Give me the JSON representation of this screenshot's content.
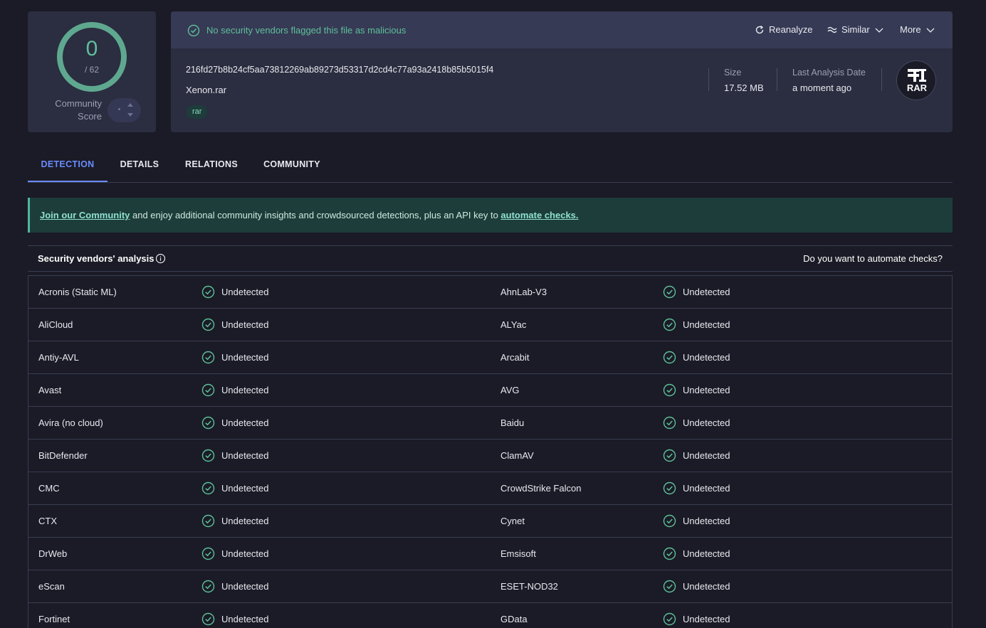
{
  "score": {
    "value": "0",
    "total": "/ 62",
    "label_line1": "Community",
    "label_line2": "Score"
  },
  "file": {
    "status": "No security vendors flagged this file as malicious",
    "reanalyze": "Reanalyze",
    "similar": "Similar",
    "more": "More",
    "hash": "216fd27b8b24cf5aa73812269ab89273d53317d2cd4c77a93a2418b85b5015f4",
    "name": "Xenon.rar",
    "tag": "rar",
    "size_label": "Size",
    "size_value": "17.52 MB",
    "date_label": "Last Analysis Date",
    "date_value": "a moment ago",
    "type_badge": "RAR"
  },
  "tabs": [
    "DETECTION",
    "DETAILS",
    "RELATIONS",
    "COMMUNITY"
  ],
  "banner": {
    "link1": "Join our Community",
    "text": " and enjoy additional community insights and crowdsourced detections, plus an API key to ",
    "link2": "automate checks."
  },
  "section": {
    "title": "Security vendors' analysis",
    "right": "Do you want to automate checks?"
  },
  "vendors": [
    {
      "left": "Acronis (Static ML)",
      "left_result": "Undetected",
      "right": "AhnLab-V3",
      "right_result": "Undetected"
    },
    {
      "left": "AliCloud",
      "left_result": "Undetected",
      "right": "ALYac",
      "right_result": "Undetected"
    },
    {
      "left": "Antiy-AVL",
      "left_result": "Undetected",
      "right": "Arcabit",
      "right_result": "Undetected"
    },
    {
      "left": "Avast",
      "left_result": "Undetected",
      "right": "AVG",
      "right_result": "Undetected"
    },
    {
      "left": "Avira (no cloud)",
      "left_result": "Undetected",
      "right": "Baidu",
      "right_result": "Undetected"
    },
    {
      "left": "BitDefender",
      "left_result": "Undetected",
      "right": "ClamAV",
      "right_result": "Undetected"
    },
    {
      "left": "CMC",
      "left_result": "Undetected",
      "right": "CrowdStrike Falcon",
      "right_result": "Undetected"
    },
    {
      "left": "CTX",
      "left_result": "Undetected",
      "right": "Cynet",
      "right_result": "Undetected"
    },
    {
      "left": "DrWeb",
      "left_result": "Undetected",
      "right": "Emsisoft",
      "right_result": "Undetected"
    },
    {
      "left": "eScan",
      "left_result": "Undetected",
      "right": "ESET-NOD32",
      "right_result": "Undetected"
    },
    {
      "left": "Fortinet",
      "left_result": "Undetected",
      "right": "GData",
      "right_result": "Undetected"
    }
  ],
  "colors": {
    "accent": "#6b8cff",
    "clean": "#5fbf9a",
    "background": "#1a1b26",
    "card": "#2b2d40"
  }
}
